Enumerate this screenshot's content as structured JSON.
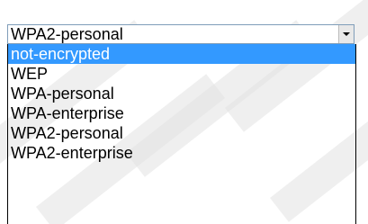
{
  "dropdown": {
    "selected_value": "WPA2-personal",
    "options": [
      "not-encrypted",
      "WEP",
      "WPA-personal",
      "WPA-enterprise",
      "WPA2-personal",
      "WPA2-enterprise"
    ],
    "highlighted_option": "not-encrypted"
  },
  "icons": {
    "dropdown_arrow": "chevron-down-icon"
  },
  "colors": {
    "highlight": "#3399ff",
    "highlight_text": "#ffffff",
    "border": "#7f9db9"
  }
}
